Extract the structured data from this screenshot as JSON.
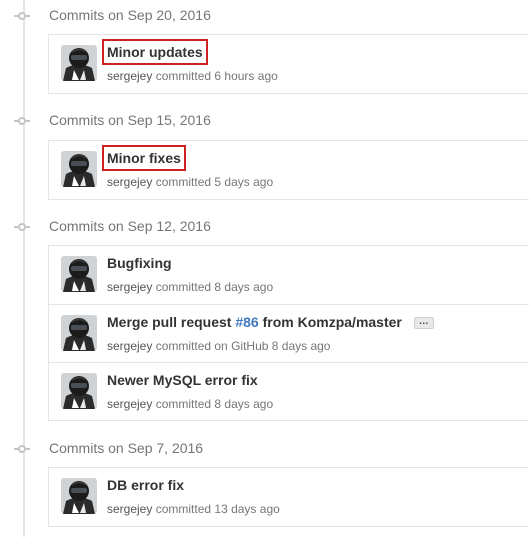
{
  "groups": [
    {
      "title": "Commits on Sep 20, 2016",
      "commits": [
        {
          "message": "Minor updates",
          "author": "sergejey",
          "action": "committed",
          "time": "6 hours ago"
        }
      ]
    },
    {
      "title": "Commits on Sep 15, 2016",
      "commits": [
        {
          "message": "Minor fixes",
          "author": "sergejey",
          "action": "committed",
          "time": "5 days ago"
        }
      ]
    },
    {
      "title": "Commits on Sep 12, 2016",
      "commits": [
        {
          "message": "Bugfixing",
          "author": "sergejey",
          "action": "committed",
          "time": "8 days ago"
        },
        {
          "message_prefix": "Merge pull request",
          "issue": "#86",
          "message_suffix": "from Komzpa/master",
          "expand_label": "…",
          "author": "sergejey",
          "action": "committed on GitHub",
          "time": "8 days ago"
        },
        {
          "message": "Newer MySQL error fix",
          "author": "sergejey",
          "action": "committed",
          "time": "8 days ago"
        }
      ]
    },
    {
      "title": "Commits on Sep 7, 2016",
      "commits": [
        {
          "message": "DB error fix",
          "author": "sergejey",
          "action": "committed",
          "time": "13 days ago"
        }
      ]
    }
  ],
  "colors": {
    "link": "#4078c0",
    "highlight_outline": "#cc2222",
    "timeline": "#e5e5e5"
  },
  "icons": {
    "avatar": "user-avatar-motorcycle-helmet",
    "timeline_node": "commit-node-icon"
  }
}
